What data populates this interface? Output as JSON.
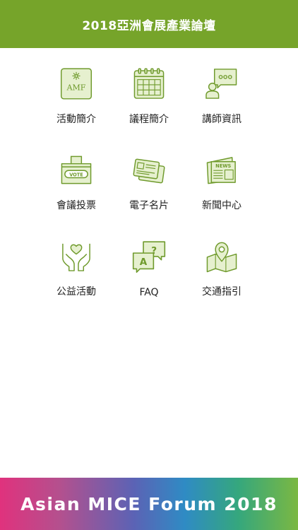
{
  "header": {
    "title": "2018亞洲會展產業論壇"
  },
  "menu": [
    {
      "label": "活動簡介",
      "icon": "amf-logo-icon"
    },
    {
      "label": "議程簡介",
      "icon": "calendar-icon"
    },
    {
      "label": "講師資訊",
      "icon": "speaker-chat-icon"
    },
    {
      "label": "會議投票",
      "icon": "vote-box-icon"
    },
    {
      "label": "電子名片",
      "icon": "business-card-icon"
    },
    {
      "label": "新聞中心",
      "icon": "newspaper-icon"
    },
    {
      "label": "公益活動",
      "icon": "charity-hands-icon"
    },
    {
      "label": "FAQ",
      "icon": "faq-chat-icon"
    },
    {
      "label": "交通指引",
      "icon": "map-pin-icon"
    }
  ],
  "icon_text": {
    "amf": "AMF",
    "vote": "VOTE",
    "news": "NEWS",
    "question": "?",
    "answer": "A"
  },
  "banner": {
    "text": "Asian MICE Forum 2018"
  },
  "colors": {
    "accent": "#76a42a",
    "icon_stroke": "#6f9a2c",
    "icon_fill": "#e6f0cf"
  }
}
